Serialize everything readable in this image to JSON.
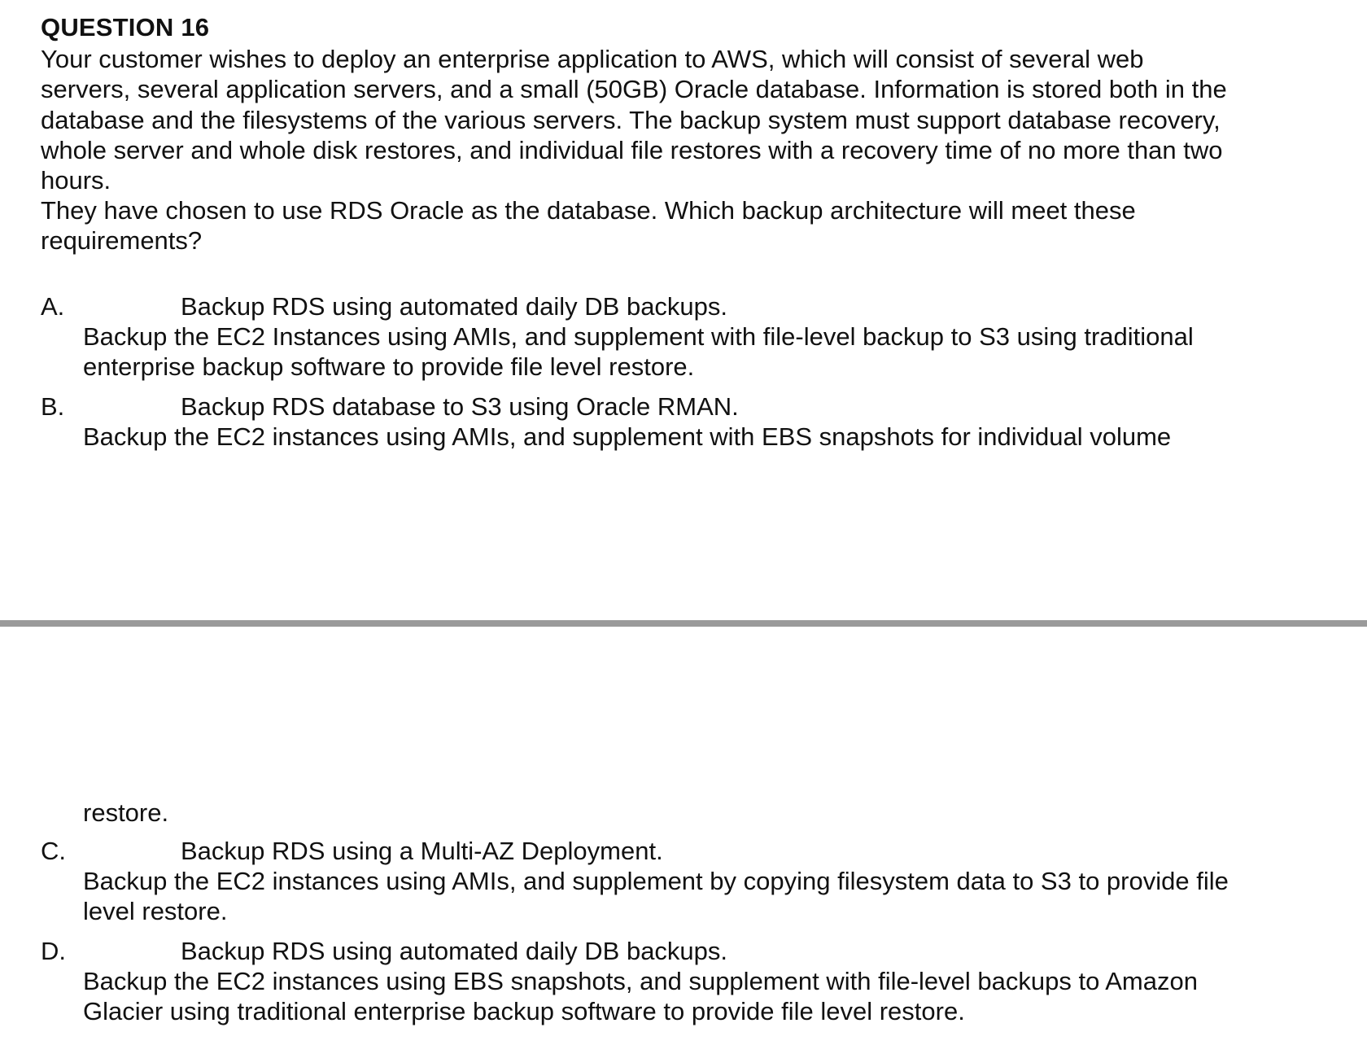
{
  "question": {
    "title": "QUESTION 16",
    "paragraph1": "Your customer wishes to deploy an enterprise application to AWS, which will consist of several web\nservers, several application servers, and a small (50GB) Oracle database. Information is stored both in the\ndatabase and the filesystems of the various servers. The backup system must support database recovery,\nwhole server and whole disk restores, and individual file restores with a recovery time of no more than two\nhours.",
    "paragraph2": "They have chosen to use RDS Oracle as the database. Which backup architecture will meet these\nrequirements?"
  },
  "options": {
    "a": {
      "letter": "A.",
      "first_line": "Backup RDS using automated daily DB backups.",
      "rest": "Backup the EC2 Instances using AMIs, and supplement with file-level backup to S3 using traditional\nenterprise backup software to provide file level restore."
    },
    "b": {
      "letter": "B.",
      "first_line": "Backup RDS database to S3 using Oracle RMAN.",
      "rest": "Backup the EC2 instances using AMIs, and supplement with EBS snapshots for individual volume",
      "continuation": "restore."
    },
    "c": {
      "letter": "C.",
      "first_line": "Backup RDS using a Multi-AZ Deployment.",
      "rest": "Backup the EC2 instances using AMIs, and supplement by copying filesystem data to S3 to provide file\nlevel restore."
    },
    "d": {
      "letter": "D.",
      "first_line": "Backup RDS using automated daily DB backups.",
      "rest": "Backup the EC2 instances using EBS snapshots, and supplement with file-level backups to Amazon\nGlacier using traditional enterprise backup software to provide file level restore."
    }
  }
}
